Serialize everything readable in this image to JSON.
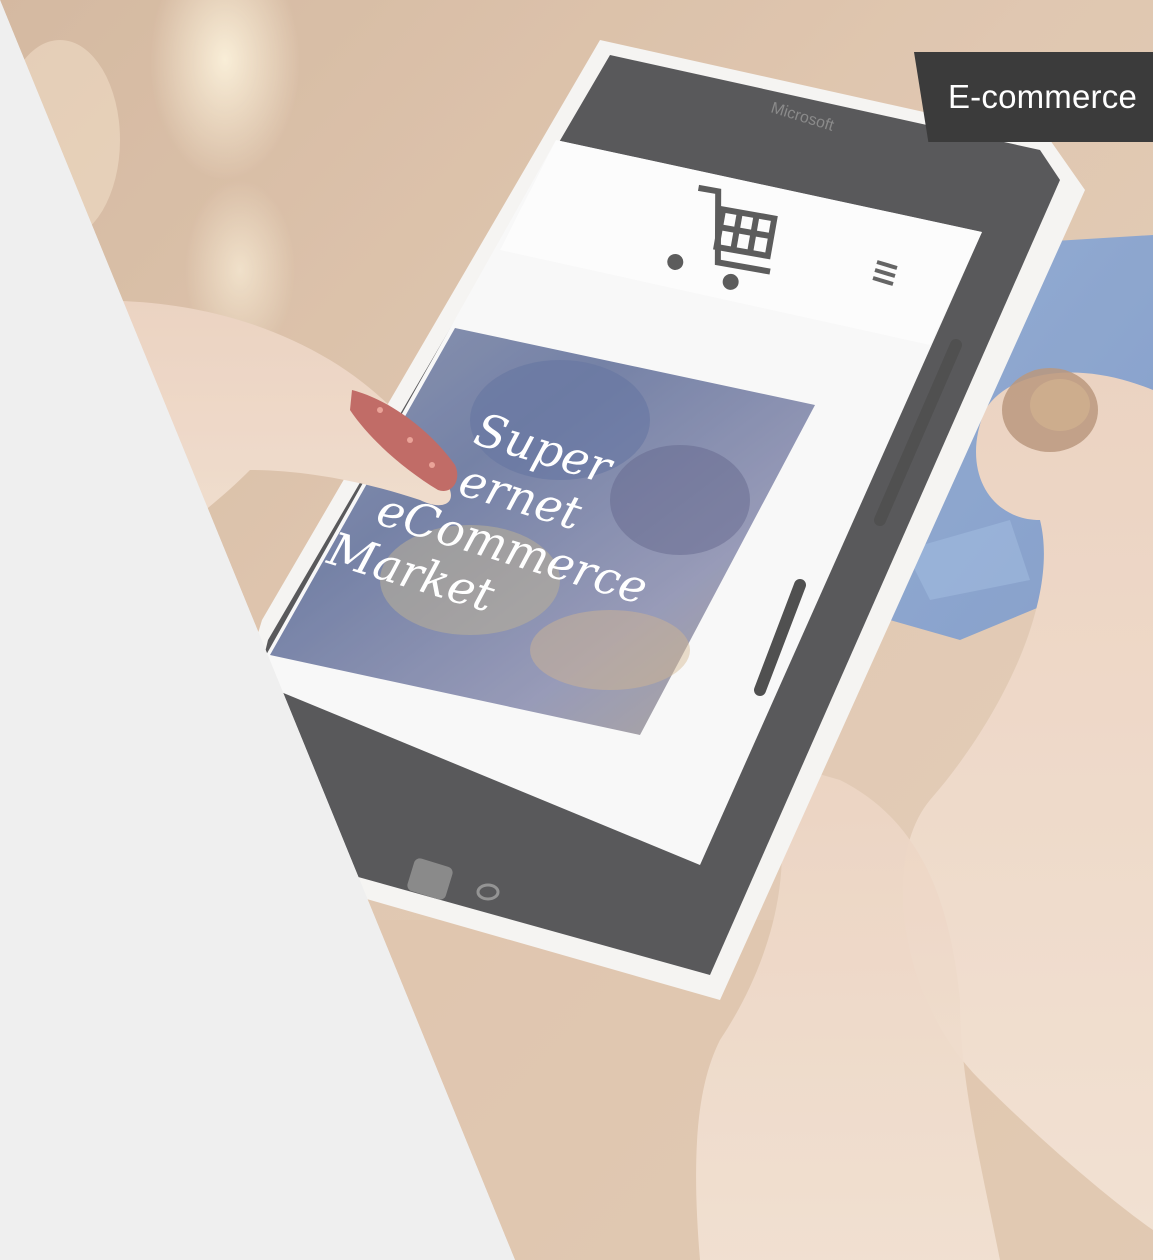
{
  "photo": {
    "subject": "hand holding smartphone showing shopping website, other hand holding blue card",
    "screen": {
      "headline_lines": [
        "Super",
        "ernet",
        "eCommerce",
        "Market"
      ],
      "cart_icon": "shopping-cart-icon",
      "menu_icon": "hamburger-menu-icon",
      "phone_brand": "Microsoft"
    }
  },
  "tag": {
    "label": "E-commerce"
  },
  "colors": {
    "panel": "#efefef",
    "tag_bg": "#3b3b3b",
    "tag_text": "#ffffff"
  }
}
